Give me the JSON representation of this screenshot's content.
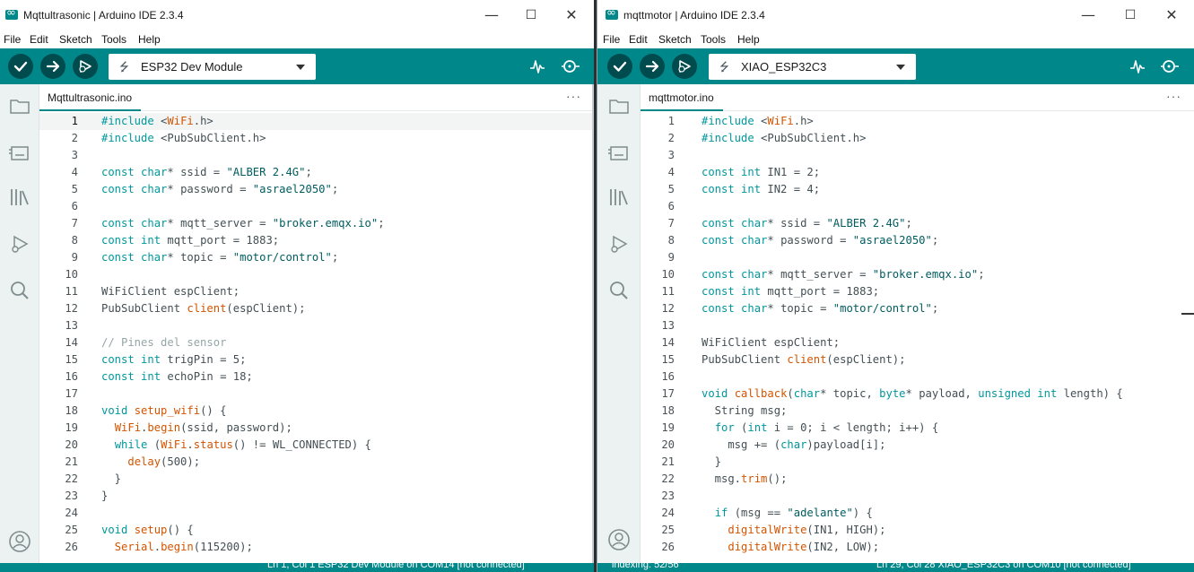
{
  "left": {
    "title": "Mqttultrasonic | Arduino IDE 2.3.4",
    "menu": [
      "File",
      "Edit",
      "Sketch",
      "Tools",
      "Help"
    ],
    "board": "ESP32 Dev Module",
    "tab": "Mqttultrasonic.ino",
    "status": "Ln 1, Col 1    ESP32 Dev Module on COM14 [not connected]",
    "lines": [
      {
        "n": "1",
        "t": "#include <WiFi.h>"
      },
      {
        "n": "2",
        "t": "#include <PubSubClient.h>"
      },
      {
        "n": "3",
        "t": ""
      },
      {
        "n": "4",
        "t": "const char* ssid = \"ALBER 2.4G\";"
      },
      {
        "n": "5",
        "t": "const char* password = \"asrael2050\";"
      },
      {
        "n": "6",
        "t": ""
      },
      {
        "n": "7",
        "t": "const char* mqtt_server = \"broker.emqx.io\";"
      },
      {
        "n": "8",
        "t": "const int mqtt_port = 1883;"
      },
      {
        "n": "9",
        "t": "const char* topic = \"motor/control\";"
      },
      {
        "n": "10",
        "t": ""
      },
      {
        "n": "11",
        "t": "WiFiClient espClient;"
      },
      {
        "n": "12",
        "t": "PubSubClient client(espClient);"
      },
      {
        "n": "13",
        "t": ""
      },
      {
        "n": "14",
        "t": "// Pines del sensor"
      },
      {
        "n": "15",
        "t": "const int trigPin = 5;"
      },
      {
        "n": "16",
        "t": "const int echoPin = 18;"
      },
      {
        "n": "17",
        "t": ""
      },
      {
        "n": "18",
        "t": "void setup_wifi() {"
      },
      {
        "n": "19",
        "t": "  WiFi.begin(ssid, password);"
      },
      {
        "n": "20",
        "t": "  while (WiFi.status() != WL_CONNECTED) {"
      },
      {
        "n": "21",
        "t": "    delay(500);"
      },
      {
        "n": "22",
        "t": "  }"
      },
      {
        "n": "23",
        "t": "}"
      },
      {
        "n": "24",
        "t": ""
      },
      {
        "n": "25",
        "t": "void setup() {"
      },
      {
        "n": "26",
        "t": "  Serial.begin(115200);"
      }
    ]
  },
  "right": {
    "title": "mqttmotor | Arduino IDE 2.3.4",
    "menu": [
      "File",
      "Edit",
      "Sketch",
      "Tools",
      "Help"
    ],
    "board": "XIAO_ESP32C3",
    "tab": "mqttmotor.ino",
    "status_left": "indexing: 52/56",
    "status": "Ln 29, Col 28    XIAO_ESP32C3 on COM10 [not connected]",
    "lines": [
      {
        "n": "1",
        "t": "#include <WiFi.h>"
      },
      {
        "n": "2",
        "t": "#include <PubSubClient.h>"
      },
      {
        "n": "3",
        "t": ""
      },
      {
        "n": "4",
        "t": "const int IN1 = 2;"
      },
      {
        "n": "5",
        "t": "const int IN2 = 4;"
      },
      {
        "n": "6",
        "t": ""
      },
      {
        "n": "7",
        "t": "const char* ssid = \"ALBER 2.4G\";"
      },
      {
        "n": "8",
        "t": "const char* password = \"asrael2050\";"
      },
      {
        "n": "9",
        "t": ""
      },
      {
        "n": "10",
        "t": "const char* mqtt_server = \"broker.emqx.io\";"
      },
      {
        "n": "11",
        "t": "const int mqtt_port = 1883;"
      },
      {
        "n": "12",
        "t": "const char* topic = \"motor/control\";"
      },
      {
        "n": "13",
        "t": ""
      },
      {
        "n": "14",
        "t": "WiFiClient espClient;"
      },
      {
        "n": "15",
        "t": "PubSubClient client(espClient);"
      },
      {
        "n": "16",
        "t": ""
      },
      {
        "n": "17",
        "t": "void callback(char* topic, byte* payload, unsigned int length) {"
      },
      {
        "n": "18",
        "t": "  String msg;"
      },
      {
        "n": "19",
        "t": "  for (int i = 0; i < length; i++) {"
      },
      {
        "n": "20",
        "t": "    msg += (char)payload[i];"
      },
      {
        "n": "21",
        "t": "  }"
      },
      {
        "n": "22",
        "t": "  msg.trim();"
      },
      {
        "n": "23",
        "t": ""
      },
      {
        "n": "24",
        "t": "  if (msg == \"adelante\") {"
      },
      {
        "n": "25",
        "t": "    digitalWrite(IN1, HIGH);"
      },
      {
        "n": "26",
        "t": "    digitalWrite(IN2, LOW);"
      }
    ]
  },
  "window_controls": {
    "minimize": "—",
    "maximize": "☐",
    "close": "✕"
  },
  "colors": {
    "teal": "#00878a",
    "dark_teal": "#004b4d",
    "keyword": "#00979c",
    "function": "#d35400",
    "string": "#005c5f",
    "comment": "#95a5a6"
  }
}
